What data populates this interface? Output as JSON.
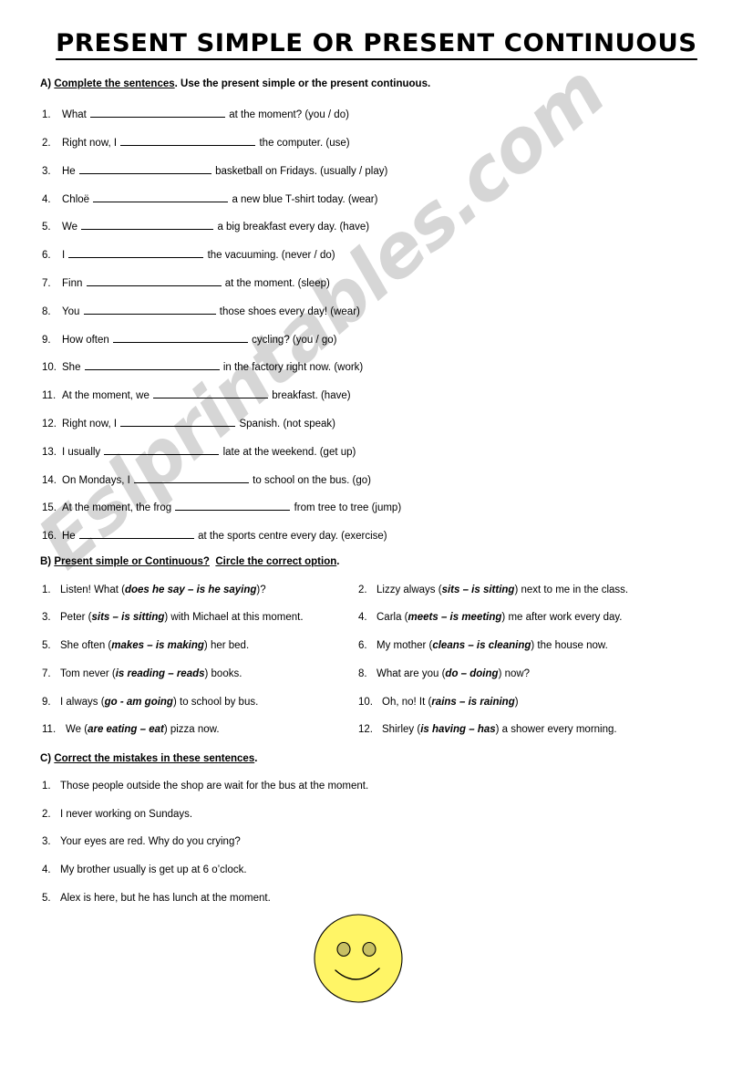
{
  "document": {
    "title": "PRESENT SIMPLE OR PRESENT CONTINUOUS",
    "watermark": "Eslprintables.com"
  },
  "section_a": {
    "letter": "A)",
    "instruction_underlined": "Complete the sentences",
    "instruction_rest": ". Use the present simple or the present continuous.",
    "items": [
      {
        "num": "1.",
        "before": "What",
        "blank": 148,
        "after": "at the moment? (you / do)"
      },
      {
        "num": "2.",
        "before": "Right now, I",
        "blank": 148,
        "after": "the computer. (use)"
      },
      {
        "num": "3.",
        "before": "He",
        "blank": 145,
        "after": "basketball on Fridays. (usually / play)"
      },
      {
        "num": "4.",
        "before": "Chloë",
        "blank": 148,
        "after": "a new blue T-shirt today. (wear)"
      },
      {
        "num": "5.",
        "before": "We",
        "blank": 145,
        "after": "a big breakfast every day. (have)"
      },
      {
        "num": "6.",
        "before": "I",
        "blank": 148,
        "after": "the vacuuming. (never / do)"
      },
      {
        "num": "7.",
        "before": "Finn",
        "blank": 148,
        "after": "at the moment. (sleep)"
      },
      {
        "num": "8.",
        "before": "You",
        "blank": 145,
        "after": "those shoes every day! (wear)"
      },
      {
        "num": "9.",
        "before": "How often",
        "blank": 148,
        "after": "cycling? (you / go)"
      },
      {
        "num": "10.",
        "before": "She",
        "blank": 148,
        "after": "in the factory right now. (work)"
      },
      {
        "num": "11.",
        "before": "At the moment, we",
        "blank": 126,
        "after": "breakfast.   (have)"
      },
      {
        "num": "12.",
        "before": "Right now, I",
        "blank": 126,
        "after": "Spanish.   (not speak)"
      },
      {
        "num": "13.",
        "before": "I  usually",
        "blank": 126,
        "after": "late at the weekend.  (get up)"
      },
      {
        "num": "14.",
        "before": "On Mondays, I",
        "blank": 126,
        "after": "to school on the bus.  (go)"
      },
      {
        "num": "15.",
        "before": "At the moment, the frog",
        "blank": 126,
        "after": "from tree to tree  (jump)"
      },
      {
        "num": "16.",
        "before": "He",
        "blank": 126,
        "after": "at the sports centre every day.  (exercise)"
      }
    ]
  },
  "section_b": {
    "letter": "B)",
    "instruction_part1": "Present simple or Continuous?",
    "instruction_part2": "Circle the correct option",
    "instruction_end": ".",
    "items": [
      {
        "num": "1.",
        "pre": "Listen! What (",
        "opt": "does he say – is he saying",
        "post": ")?"
      },
      {
        "num": "2.",
        "pre": "Lizzy always (",
        "opt": "sits – is sitting",
        "post": ") next to me in the class."
      },
      {
        "num": "3.",
        "pre": "Peter (",
        "opt": "sits – is sitting",
        "post": ") with Michael at this moment."
      },
      {
        "num": "4.",
        "pre": "Carla (",
        "opt": "meets – is meeting",
        "post": ") me after work every day."
      },
      {
        "num": "5.",
        "pre": "She often (",
        "opt": "makes – is making",
        "post": ") her bed."
      },
      {
        "num": "6.",
        "pre": "My mother (",
        "opt": "cleans – is cleaning",
        "post": ") the house now."
      },
      {
        "num": "7.",
        "pre": "Tom never (",
        "opt": "is reading – reads",
        "post": ") books."
      },
      {
        "num": "8.",
        "pre": "What are you (",
        "opt": "do – doing",
        "post": ") now?"
      },
      {
        "num": "9.",
        "pre": "I always (",
        "opt": "go - am going",
        "post": ") to school by bus."
      },
      {
        "num": "10.",
        "pre": "Oh, no! It (",
        "opt": "rains – is raining",
        "post": ")"
      },
      {
        "num": "11.",
        "pre": "We (",
        "opt": "are eating – eat",
        "post": ") pizza now."
      },
      {
        "num": "12.",
        "pre": "Shirley (",
        "opt": "is having – has",
        "post": ") a shower every morning."
      }
    ]
  },
  "section_c": {
    "letter": "C)",
    "instruction_underlined": "Correct the mistakes in these sentences",
    "instruction_rest": ".",
    "items": [
      {
        "num": "1.",
        "text": "Those people outside the shop are wait for the bus at the moment."
      },
      {
        "num": "2.",
        "text": "I never working on Sundays."
      },
      {
        "num": "3.",
        "text": "Your eyes are red.  Why do you crying?"
      },
      {
        "num": "4.",
        "text": "My brother usually is get up at 6 o’clock."
      },
      {
        "num": "5.",
        "text": "Alex is here, but he has lunch at the moment."
      }
    ]
  },
  "decoration": {
    "smiley_face_color": "#FFF566",
    "smiley_eye_color": "#C8C063",
    "smiley_outline_color": "#000000",
    "smiley_name": "smiley-face"
  }
}
